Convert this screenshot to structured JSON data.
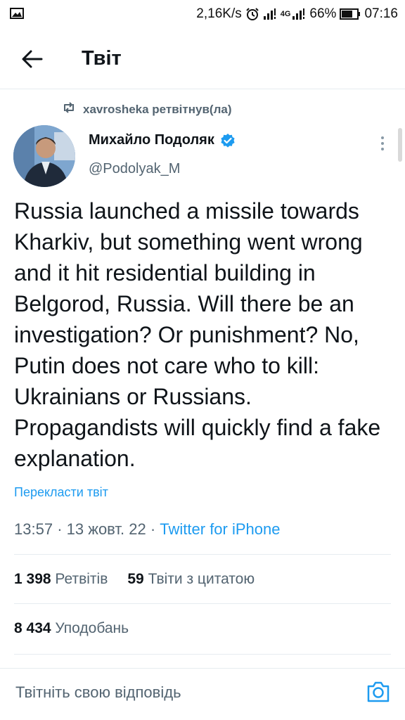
{
  "status_bar": {
    "speed": "2,16K/s",
    "network_label": "4G",
    "battery": "66%",
    "time": "07:16"
  },
  "header": {
    "title": "Твіт"
  },
  "retweet_context": {
    "text": "xavrosheka ретвітнув(ла)"
  },
  "author": {
    "name": "Михайло Подоляк",
    "handle": "@Podolyak_M",
    "verified": true
  },
  "tweet": {
    "text": "Russia launched a missile towards Kharkiv, but something went wrong and it hit residential building in Belgorod, Russia. Will there be an investigation? Or punishment? No, Putin does not care who to kill: Ukrainians or Russians. Propagandists will quickly find a fake explanation.",
    "translate_label": "Перекласти твіт",
    "time": "13:57",
    "date": "13 жовт. 22",
    "separator": "·",
    "source": "Twitter for iPhone"
  },
  "stats": {
    "retweets_count": "1 398",
    "retweets_label": "Ретвітів",
    "quotes_count": "59",
    "quotes_label": "Твіти з цитатою",
    "likes_count": "8 434",
    "likes_label": "Уподобань"
  },
  "reply": {
    "placeholder": "Твітніть свою відповідь"
  },
  "colors": {
    "accent": "#1d9bf0",
    "text": "#0f1419",
    "secondary": "#536471",
    "divider": "#e6ecf0"
  }
}
